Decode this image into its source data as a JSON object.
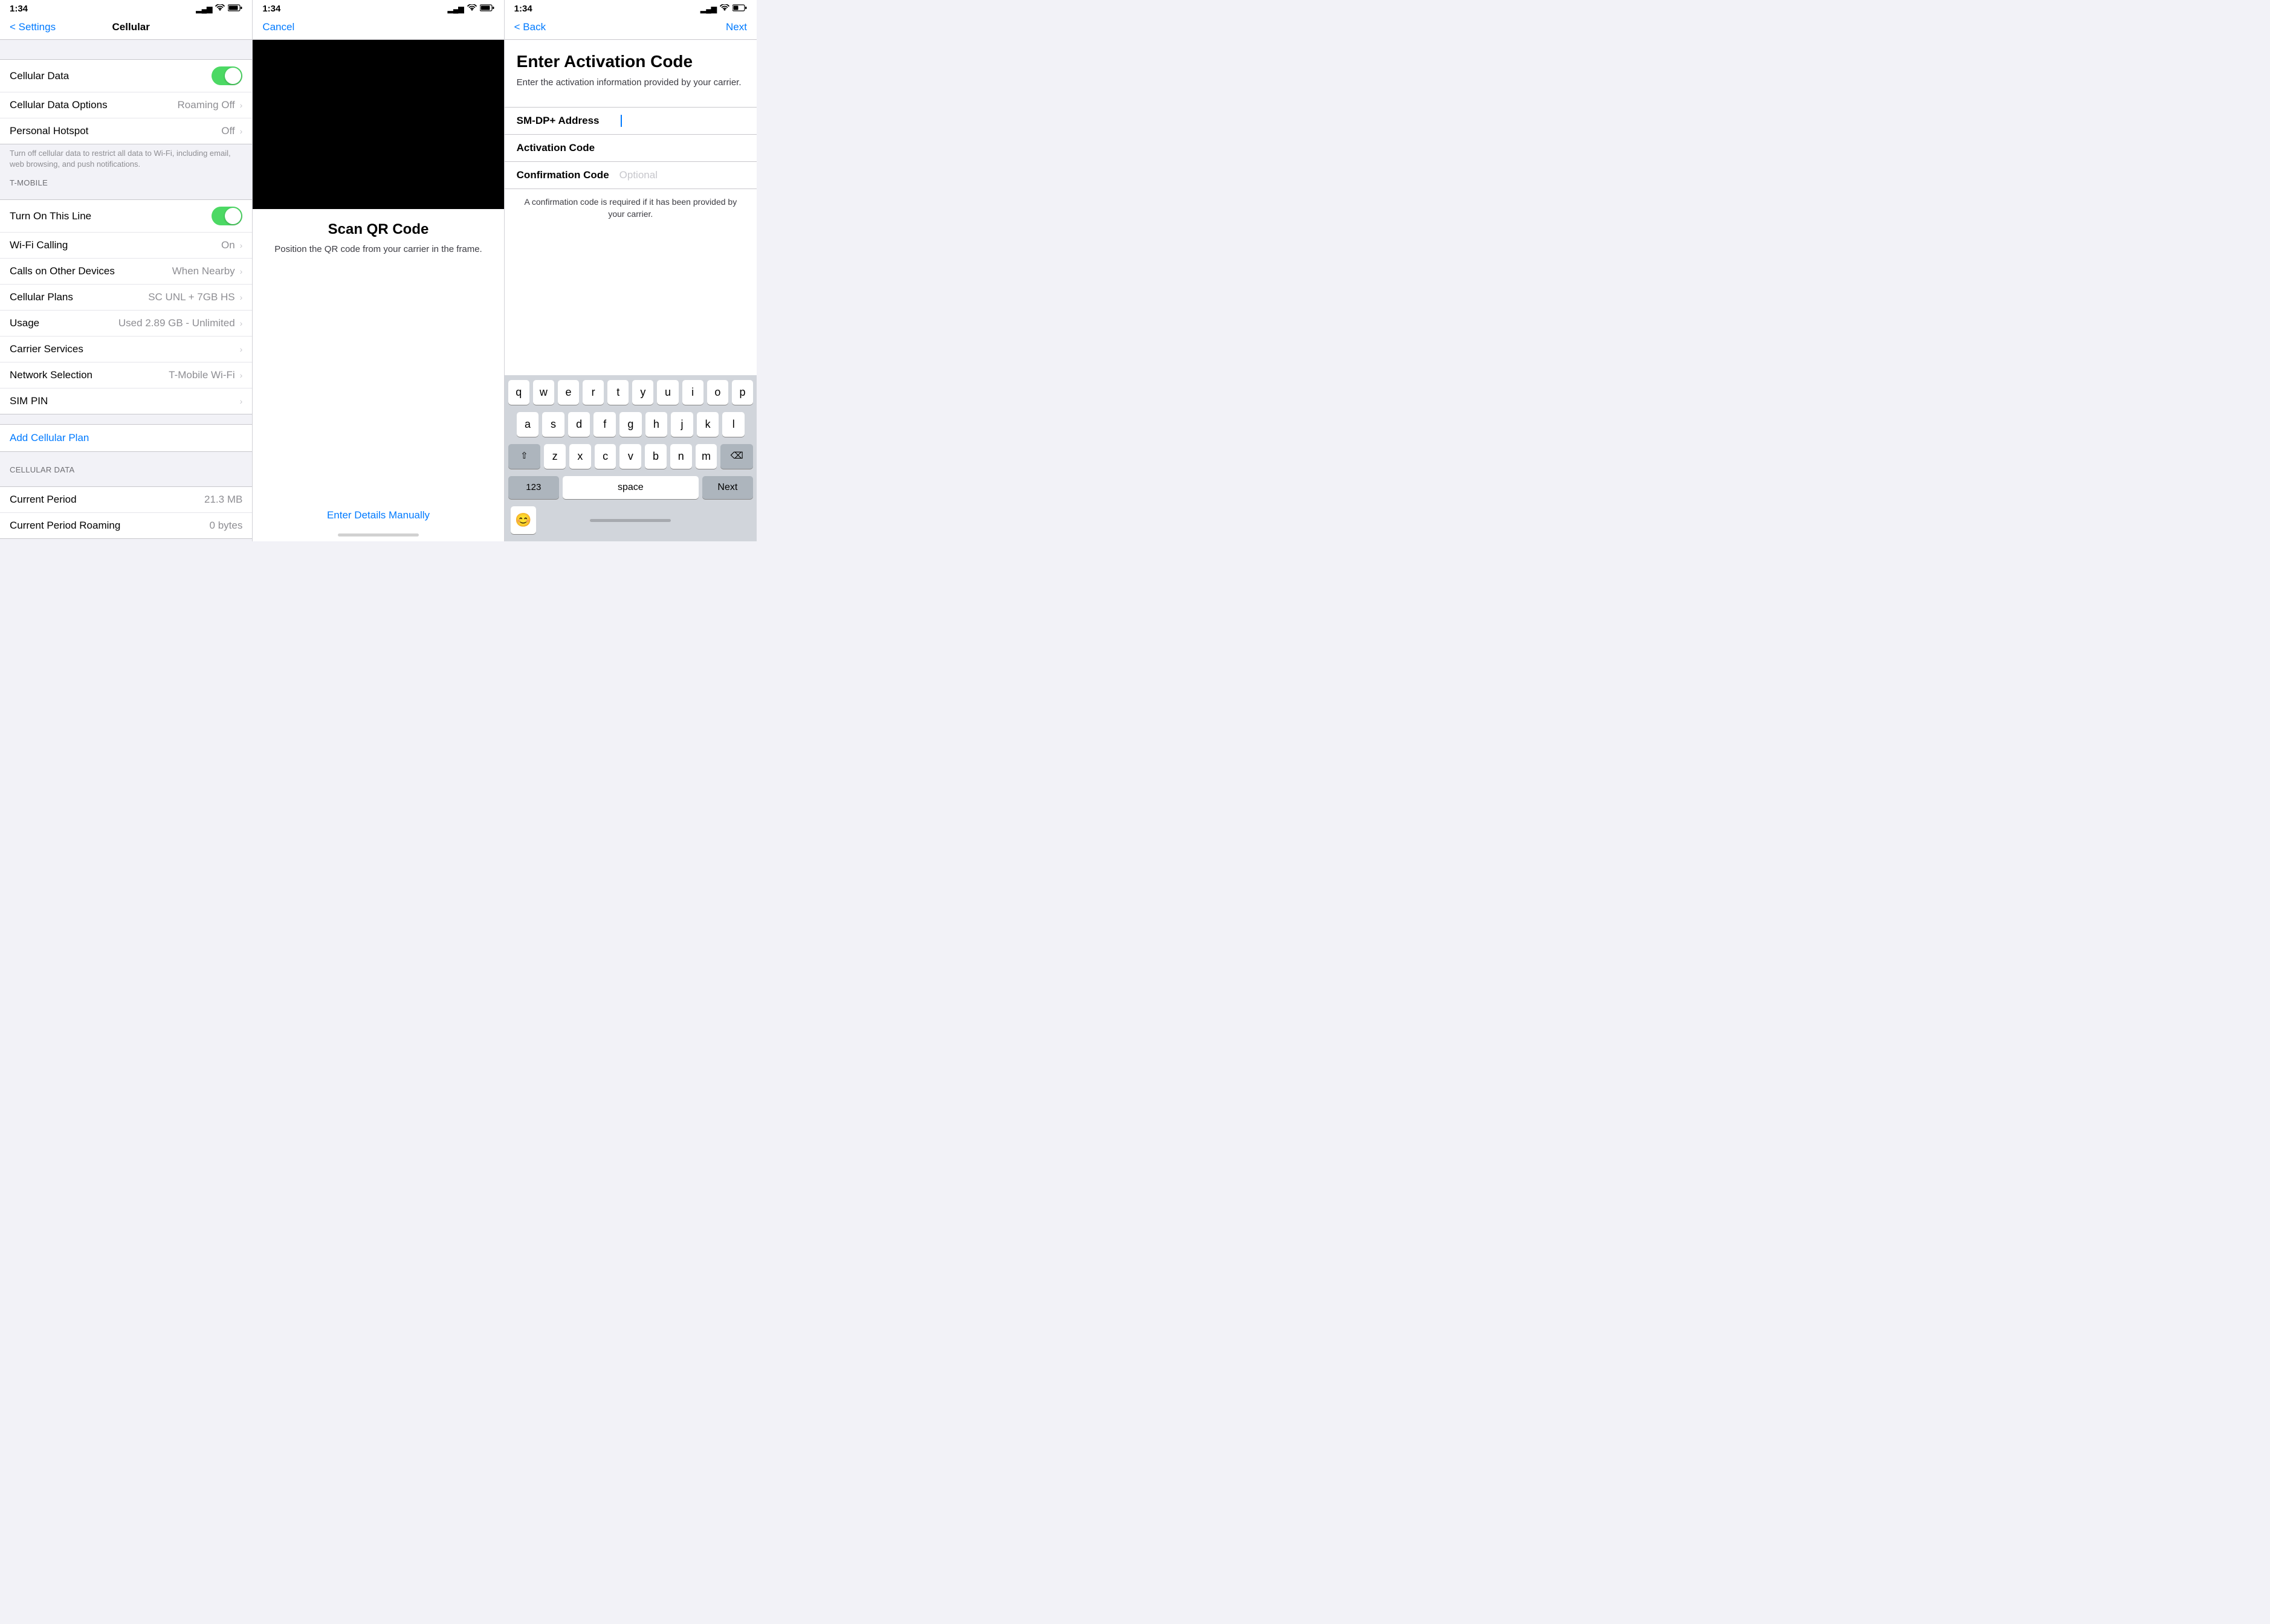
{
  "panel1": {
    "status": {
      "time": "1:34",
      "location_icon": "▶",
      "signal": "▂▄▆",
      "wifi": "wifi",
      "battery": "battery"
    },
    "nav": {
      "back_label": "< Settings",
      "title": "Cellular"
    },
    "cellular_data": {
      "label": "Cellular Data",
      "toggle": "on"
    },
    "cellular_data_options": {
      "label": "Cellular Data Options",
      "value": "Roaming Off"
    },
    "personal_hotspot": {
      "label": "Personal Hotspot",
      "value": "Off"
    },
    "hint": "Turn off cellular data to restrict all data to Wi-Fi, including email, web browsing, and push notifications.",
    "section_tmobile": "T-MOBILE",
    "turn_on_line": {
      "label": "Turn On This Line",
      "toggle": "on"
    },
    "wifi_calling": {
      "label": "Wi-Fi Calling",
      "value": "On"
    },
    "calls_other": {
      "label": "Calls on Other Devices",
      "value": "When Nearby"
    },
    "cellular_plans": {
      "label": "Cellular Plans",
      "value": "SC UNL + 7GB HS"
    },
    "usage": {
      "label": "Usage",
      "value": "Used 2.89 GB - Unlimited"
    },
    "carrier_services": {
      "label": "Carrier Services"
    },
    "network_selection": {
      "label": "Network Selection",
      "value": "T-Mobile Wi-Fi"
    },
    "sim_pin": {
      "label": "SIM PIN"
    },
    "add_cellular": "Add Cellular Plan",
    "section_cellular_data": "CELLULAR DATA",
    "current_period": {
      "label": "Current Period",
      "value": "21.3 MB"
    },
    "current_period_roaming": {
      "label": "Current Period Roaming",
      "value": "0 bytes"
    }
  },
  "panel2": {
    "status": {
      "time": "1:34",
      "location_icon": "▶"
    },
    "nav": {
      "cancel_label": "Cancel"
    },
    "qr_title": "Scan QR Code",
    "qr_subtitle": "Position the QR code from your carrier in the frame.",
    "enter_manually": "Enter Details Manually"
  },
  "panel3": {
    "status": {
      "time": "1:34",
      "location_icon": "▶"
    },
    "nav": {
      "back_label": "< Back",
      "next_label": "Next"
    },
    "title": "Enter Activation Code",
    "subtitle": "Enter the activation information provided by your carrier.",
    "fields": {
      "smdp_label": "SM-DP+ Address",
      "activation_label": "Activation Code",
      "confirmation_label": "Confirmation Code",
      "confirmation_placeholder": "Optional"
    },
    "field_hint": "A confirmation code is required if it has been provided by your carrier.",
    "keyboard": {
      "row1": [
        "q",
        "w",
        "e",
        "r",
        "t",
        "y",
        "u",
        "i",
        "o",
        "p"
      ],
      "row2": [
        "a",
        "s",
        "d",
        "f",
        "g",
        "h",
        "j",
        "k",
        "l"
      ],
      "row3": [
        "z",
        "x",
        "c",
        "v",
        "b",
        "n",
        "m"
      ],
      "shift": "⇧",
      "delete": "⌫",
      "numbers": "123",
      "space": "space",
      "next": "Next",
      "emoji": "😊"
    }
  }
}
